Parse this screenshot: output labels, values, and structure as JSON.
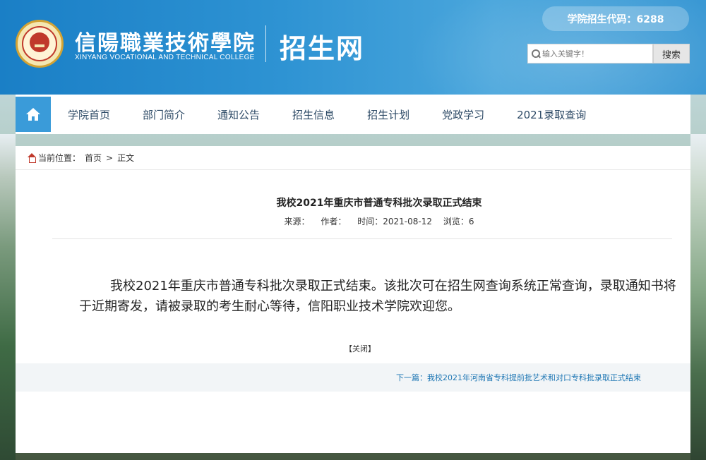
{
  "header": {
    "college_name": "信陽職業技術學院",
    "college_en": "XINYANG VOCATIONAL AND TECHNICAL COLLEGE",
    "site_name": "招生网",
    "code_badge": "学院招生代码：6288",
    "search": {
      "placeholder": "输入关键字！",
      "button_label": "搜索"
    }
  },
  "nav": {
    "items": [
      "学院首页",
      "部门简介",
      "通知公告",
      "招生信息",
      "招生计划",
      "党政学习",
      "2021录取查询"
    ]
  },
  "breadcrumb": {
    "prefix": "当前位置：",
    "home": "首页",
    "sep": ">",
    "current": "正文"
  },
  "article": {
    "title": "我校2021年重庆市普通专科批次录取正式结束",
    "meta": {
      "source": "来源：",
      "author": "作者：",
      "time": "时间：2021-08-12",
      "views": "浏览：6"
    },
    "body": "我校2021年重庆市普通专科批次录取正式结束。该批次可在招生网查询系统正常查询，录取通知书将于近期寄发，请被录取的考生耐心等待，信阳职业技术学院欢迎您。",
    "close_label": "【关闭】",
    "next_label": "下一篇：我校2021年河南省专科提前批艺术和对口专科批录取正式结束"
  }
}
